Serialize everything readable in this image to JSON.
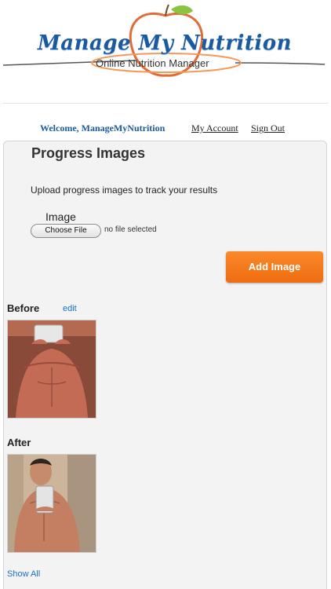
{
  "header": {
    "logo_title": "Manage My Nutrition",
    "logo_subtitle": "Online Nutrition Manager"
  },
  "welcome": {
    "text": "Welcome, ManageMyNutrition",
    "my_account": "My Account",
    "sign_out": "Sign Out"
  },
  "panel": {
    "title": "Progress Images",
    "description": "Upload progress images to track your results",
    "image_label": "Image",
    "choose_file_label": "Choose File",
    "no_file_text": "no file selected",
    "add_image_label": "Add Image"
  },
  "before": {
    "label": "Before",
    "edit_label": "edit",
    "photo_icon": "before-progress-photo"
  },
  "after": {
    "label": "After",
    "photo_icon": "after-progress-photo"
  },
  "show_all_label": "Show All",
  "colors": {
    "brand_blue": "#1c5aa0",
    "accent_orange": "#f07a1c",
    "link_blue": "#1a6fcb",
    "panel_bg": "#f3f3f3"
  }
}
